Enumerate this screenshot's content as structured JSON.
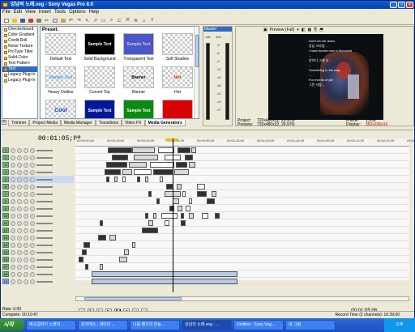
{
  "window": {
    "title": "강남의 노래.veg - Sony Vegas Pro 8.0",
    "minimize": "_",
    "maximize": "□",
    "close": "×"
  },
  "menu": [
    "File",
    "Edit",
    "View",
    "Insert",
    "Tools",
    "Options",
    "Help"
  ],
  "explorer": {
    "items": [
      "Checkerboard",
      "Color Gradient",
      "Credit Roll",
      "Noise Texture",
      "ProType Titler",
      "Solid Color",
      "Text Pattern",
      "Text",
      "Legacy Plug-In",
      "Legacy Plug-In"
    ],
    "selected_index": 7
  },
  "presets": {
    "label": "Preset:",
    "items": [
      {
        "thumb": "",
        "caption": "Default Text",
        "style": "checker"
      },
      {
        "thumb": "Sample Text",
        "caption": "Solid Background",
        "style": "black"
      },
      {
        "thumb": "Sample Text",
        "caption": "Transparent Text",
        "style": "blue"
      },
      {
        "thumb": "",
        "caption": "Soft Shadow",
        "style": "checker"
      },
      {
        "thumb": "Sample Text",
        "caption": "Heavy Outline",
        "style": "checker"
      },
      {
        "thumb": "",
        "caption": "Curved Top",
        "style": "checker"
      },
      {
        "thumb": "Banner",
        "caption": "Banner",
        "style": "checker"
      },
      {
        "thumb": "Hot",
        "caption": "Hot",
        "style": "checker"
      },
      {
        "thumb": "Cool",
        "caption": "",
        "style": "checker"
      },
      {
        "thumb": "Sample Text",
        "caption": "",
        "style": "navy"
      },
      {
        "thumb": "Sample Text",
        "caption": "",
        "style": "green"
      },
      {
        "thumb": "",
        "caption": "",
        "style": "red"
      }
    ]
  },
  "tabs": [
    "Trimmer",
    "Project Media",
    "Media Manager",
    "Transitions",
    "Video FX",
    "Media Generators"
  ],
  "active_tab": "Media Generators",
  "master": {
    "title": "Master",
    "left_value": "-Inf.",
    "right_value": "-Inf.",
    "scale": [
      "-3",
      "-6",
      "-9",
      "-12",
      "-15",
      "-18",
      "-21",
      "-24",
      "-27"
    ],
    "bottom_left": "0.0",
    "bottom_right": "0.0"
  },
  "preview": {
    "mode": "Preview (Full)",
    "lines": [
      "Don't let me down",
      "강남 스타일 ...",
      "I have turned over a thousand",
      "...",
      "양이다 그래 난 ...",
      "...",
      "Something in the way",
      "...",
      "For events of girl",
      "그런 사람 ..."
    ],
    "project_label": "Project:",
    "project_value": "720x480x32, 29.970i",
    "preview_label": "Preview:",
    "preview_value": "720x480x32, 29.970i",
    "frame_label": "Frame:",
    "frame_value": "1,956",
    "display_label": "Display:",
    "display_value": "360x236x16"
  },
  "timeline": {
    "timecode": "00:01:05;08",
    "ruler": [
      "00:00:00;00",
      "00:00:15;00",
      "00:00:29;29",
      "00:00:44;29",
      "00:00:59;28",
      "00:01:15;00",
      "00:01:29;29",
      "00:01:44;29",
      "00:01:59;28",
      "00:02:14;29",
      "00:02:29;29",
      "00:02:44;29"
    ],
    "tracks": [
      "1",
      "2",
      "3",
      "4",
      "5",
      "6",
      "7",
      "8",
      "9",
      "10",
      "11",
      "12",
      "13",
      "14",
      "15",
      "16",
      "17",
      "18"
    ],
    "audio_tracks": [
      "19"
    ],
    "transport_end": "00:01:05;08",
    "rate": "Rate: 0.00"
  },
  "status": {
    "left": "Complete: 00:10:47",
    "right": "Record Time (2 channels): 16:39:00"
  },
  "taskbar": {
    "start": "시작",
    "tasks": [
      "애교걸파이 노래의 ...",
      "프리에스 : 내이미 ...",
      "나를 팬츠의 만능 ...",
      "강남의 노래.veg - ...",
      "Untitled - Sony Veg...",
      "내 그림"
    ],
    "clock": "오후"
  }
}
